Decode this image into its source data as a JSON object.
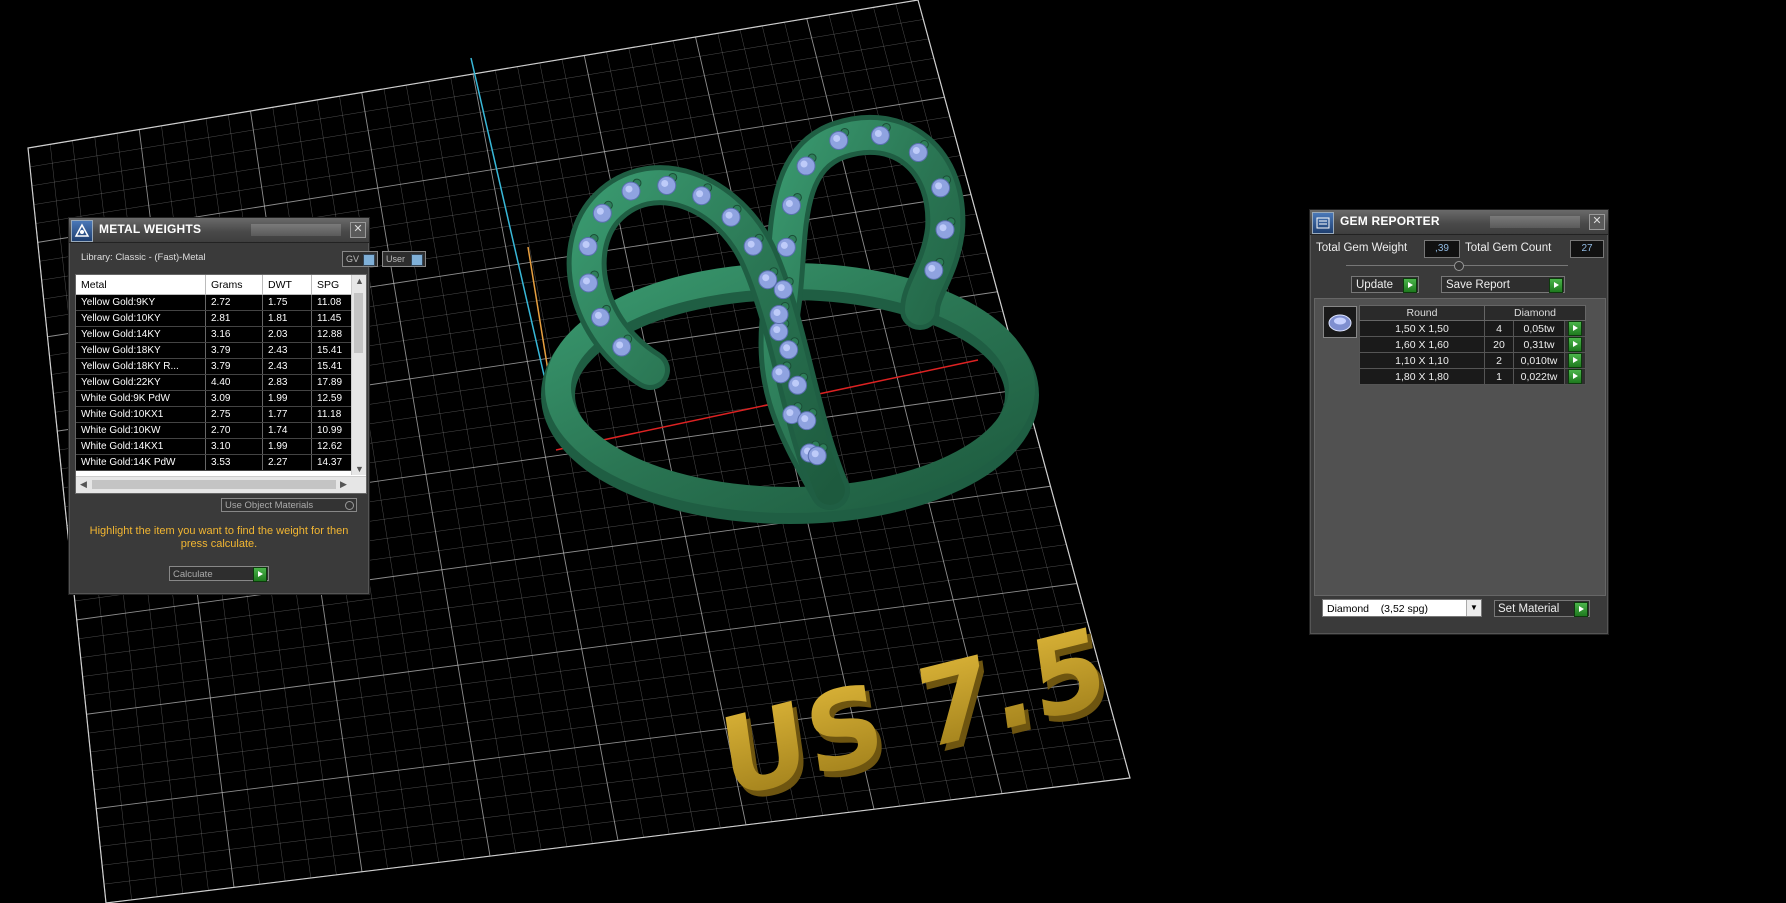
{
  "metal_weights": {
    "title": "METAL WEIGHTS",
    "library": "Library: Classic - (Fast)-Metal",
    "gv_label": "GV",
    "user_label": "User",
    "columns": [
      "Metal",
      "Grams",
      "DWT",
      "SPG"
    ],
    "rows": [
      [
        "Yellow Gold:9KY",
        "2.72",
        "1.75",
        "11.08"
      ],
      [
        "Yellow Gold:10KY",
        "2.81",
        "1.81",
        "11.45"
      ],
      [
        "Yellow Gold:14KY",
        "3.16",
        "2.03",
        "12.88"
      ],
      [
        "Yellow Gold:18KY",
        "3.79",
        "2.43",
        "15.41"
      ],
      [
        "Yellow Gold:18KY R...",
        "3.79",
        "2.43",
        "15.41"
      ],
      [
        "Yellow Gold:22KY",
        "4.40",
        "2.83",
        "17.89"
      ],
      [
        "White Gold:9K PdW",
        "3.09",
        "1.99",
        "12.59"
      ],
      [
        "White Gold:10KX1",
        "2.75",
        "1.77",
        "11.18"
      ],
      [
        "White Gold:10KW",
        "2.70",
        "1.74",
        "10.99"
      ],
      [
        "White Gold:14KX1",
        "3.10",
        "1.99",
        "12.62"
      ],
      [
        "White Gold:14K PdW",
        "3.53",
        "2.27",
        "14.37"
      ]
    ],
    "use_object_materials": "Use Object Materials",
    "hint": "Highlight the item you want to find the weight for then press calculate.",
    "calculate_label": "Calculate"
  },
  "gem_reporter": {
    "title": "GEM REPORTER",
    "total_weight_label": "Total Gem Weight",
    "total_weight_value": ",39",
    "total_count_label": "Total Gem Count",
    "total_count_value": "27",
    "update_label": "Update",
    "save_report_label": "Save Report",
    "table_headers": [
      "Round",
      "Diamond"
    ],
    "rows": [
      [
        "1,50 X 1,50",
        "4",
        "0,05tw"
      ],
      [
        "1,60 X 1,60",
        "20",
        "0,31tw"
      ],
      [
        "1,10 X 1,10",
        "2",
        "0,010tw"
      ],
      [
        "1,80 X 1,80",
        "1",
        "0,022tw"
      ]
    ],
    "material_select": "Diamond    (3,52 spg)",
    "set_material_label": "Set Material"
  },
  "viewport": {
    "size_text": "US 7.5",
    "colors": {
      "ring": "#2f7a5a",
      "gems": "#8fa3e0",
      "text": "#c9a227",
      "grid": "#bdbdbd",
      "axis_x": "#d22",
      "axis_y": "#e8a040",
      "axis_z": "#38b8d8"
    }
  }
}
